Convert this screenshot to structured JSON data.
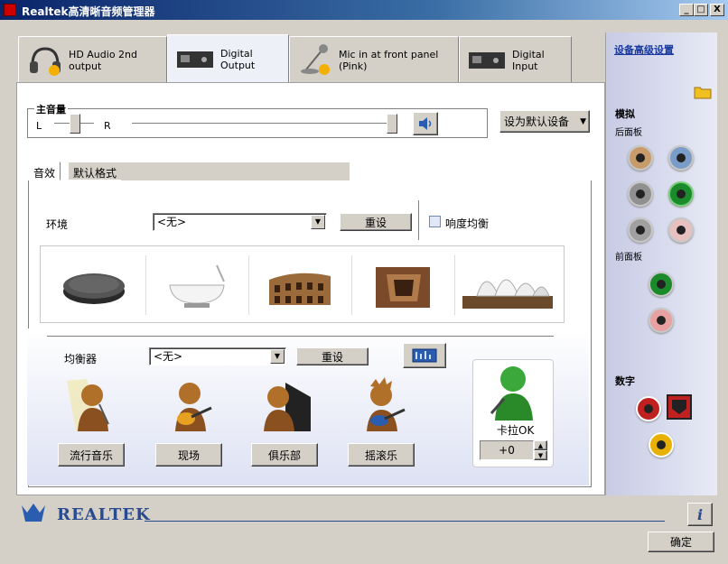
{
  "window": {
    "title": "Realtek高清晰音频管理器",
    "min": "_",
    "max": "□",
    "close": "X"
  },
  "tabs": [
    {
      "label": "HD Audio 2nd output",
      "icon": "headphones-icon"
    },
    {
      "label": "Digital Output",
      "icon": "digital-device-icon"
    },
    {
      "label": "Mic in at front panel (Pink)",
      "icon": "microphone-icon"
    },
    {
      "label": "Digital Input",
      "icon": "digital-input-icon"
    }
  ],
  "volume": {
    "title": "主音量",
    "left": "L",
    "right": "R",
    "balance": 0.5,
    "level": 1.0
  },
  "set_default": "设为默认设备",
  "subtabs": [
    "音效",
    "默认格式"
  ],
  "environment": {
    "label": "环境",
    "value": "<无>",
    "reset": "重设",
    "loudness": "响度均衡",
    "icons": [
      "stone-icon",
      "bathtub-icon",
      "colosseum-icon",
      "stone-room-icon",
      "opera-house-icon"
    ]
  },
  "equalizer": {
    "label": "均衡器",
    "value": "<无>",
    "reset": "重设",
    "presets": [
      "流行音乐",
      "现场",
      "俱乐部",
      "摇滚乐"
    ]
  },
  "karaoke": {
    "label": "卡拉OK",
    "value": "+0"
  },
  "right": {
    "advanced": "设备高级设置",
    "analog": "模拟",
    "back_panel": "后面板",
    "front_panel": "前面板",
    "digital": "数字"
  },
  "brand": "REALTEK",
  "ok": "确定",
  "info": "i",
  "colors": {
    "title": "#0a246a",
    "jack_tan": "#c89b6a",
    "jack_blue": "#7a9cc8",
    "jack_gray": "#909090",
    "jack_green": "#1a8a2a",
    "jack_pink": "#e8a0a0",
    "jack_red": "#c02020",
    "jack_yellow": "#e8b000"
  }
}
